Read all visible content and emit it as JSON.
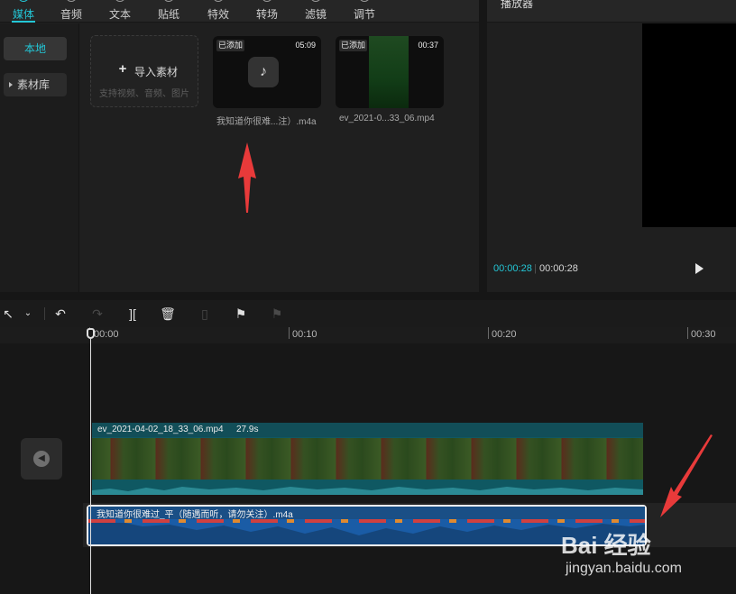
{
  "colors": {
    "accent": "#23c6d6",
    "annotation_arrow": "#e83a3a",
    "video_track": "#0f5862",
    "audio_track": "#1a5ca6"
  },
  "top_tabs": [
    {
      "label": "媒体",
      "icon": "media-icon",
      "active": true
    },
    {
      "label": "音频",
      "icon": "audio-icon",
      "active": false
    },
    {
      "label": "文本",
      "icon": "text-icon",
      "active": false
    },
    {
      "label": "贴纸",
      "icon": "sticker-icon",
      "active": false
    },
    {
      "label": "特效",
      "icon": "effects-icon",
      "active": false
    },
    {
      "label": "转场",
      "icon": "transition-icon",
      "active": false
    },
    {
      "label": "滤镜",
      "icon": "filter-icon",
      "active": false
    },
    {
      "label": "调节",
      "icon": "adjust-icon",
      "active": false
    }
  ],
  "left_nav": {
    "local": "本地",
    "library": "素材库"
  },
  "import": {
    "label": "导入素材",
    "hint": "支持视频、音频、图片"
  },
  "media_items": [
    {
      "badge": "已添加",
      "duration": "05:09",
      "name": "我知道你很难...注）.m4a",
      "icon": "tiktok-note-icon"
    },
    {
      "badge": "已添加",
      "duration": "00:37",
      "name": "ev_2021-0...33_06.mp4"
    }
  ],
  "player": {
    "title": "播放器",
    "current_time": "00:00:28",
    "separator": "|",
    "total_time": "00:00:28"
  },
  "toolbar": {
    "tools": [
      {
        "name": "select-tool",
        "icon": "cursor-icon"
      },
      {
        "name": "undo",
        "icon": "undo-icon"
      },
      {
        "name": "redo",
        "icon": "redo-icon",
        "disabled": true
      },
      {
        "name": "split",
        "icon": "split-icon"
      },
      {
        "name": "delete",
        "icon": "trash-icon"
      },
      {
        "name": "freeze",
        "icon": "freeze-icon",
        "disabled": true
      },
      {
        "name": "marker",
        "icon": "flag-icon"
      },
      {
        "name": "marker-remove",
        "icon": "flag-disabled-icon",
        "disabled": true
      }
    ]
  },
  "ruler": {
    "ticks": [
      "00:00",
      "00:10",
      "00:20",
      "00:30"
    ]
  },
  "tracks": {
    "video": {
      "name": "ev_2021-04-02_18_33_06.mp4",
      "duration": "27.9s"
    },
    "audio": {
      "name": "我知道你很难过_平（随遇而听，请勿关注）.m4a"
    }
  },
  "watermark": {
    "logo": "Bai 经验",
    "url": "jingyan.baidu.com"
  }
}
